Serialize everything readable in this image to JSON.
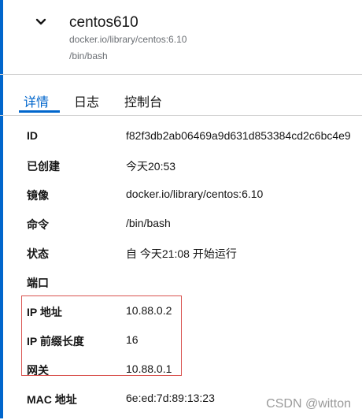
{
  "header": {
    "title": "centos610",
    "image": "docker.io/library/centos:6.10",
    "command": "/bin/bash"
  },
  "tabs": [
    {
      "label": "详情"
    },
    {
      "label": "日志"
    },
    {
      "label": "控制台"
    }
  ],
  "active_tab": "详情",
  "details": [
    {
      "label": "ID",
      "value": "f82f3db2ab06469a9d631d853384cd2c6bc4e9"
    },
    {
      "label": "已创建",
      "value": "今天20:53"
    },
    {
      "label": "镜像",
      "value": "docker.io/library/centos:6.10"
    },
    {
      "label": "命令",
      "value": "/bin/bash"
    },
    {
      "label": "状态",
      "value": "自 今天21:08 开始运行"
    },
    {
      "label": "端口",
      "value": ""
    },
    {
      "label": "IP 地址",
      "value": "10.88.0.2"
    },
    {
      "label": "IP 前缀长度",
      "value": "16"
    },
    {
      "label": "网关",
      "value": "10.88.0.1"
    },
    {
      "label": "MAC 地址",
      "value": "6e:ed:7d:89:13:23"
    }
  ],
  "watermark": "CSDN @witton",
  "colors": {
    "accent": "#0066cc",
    "highlight": "#d9534f"
  }
}
